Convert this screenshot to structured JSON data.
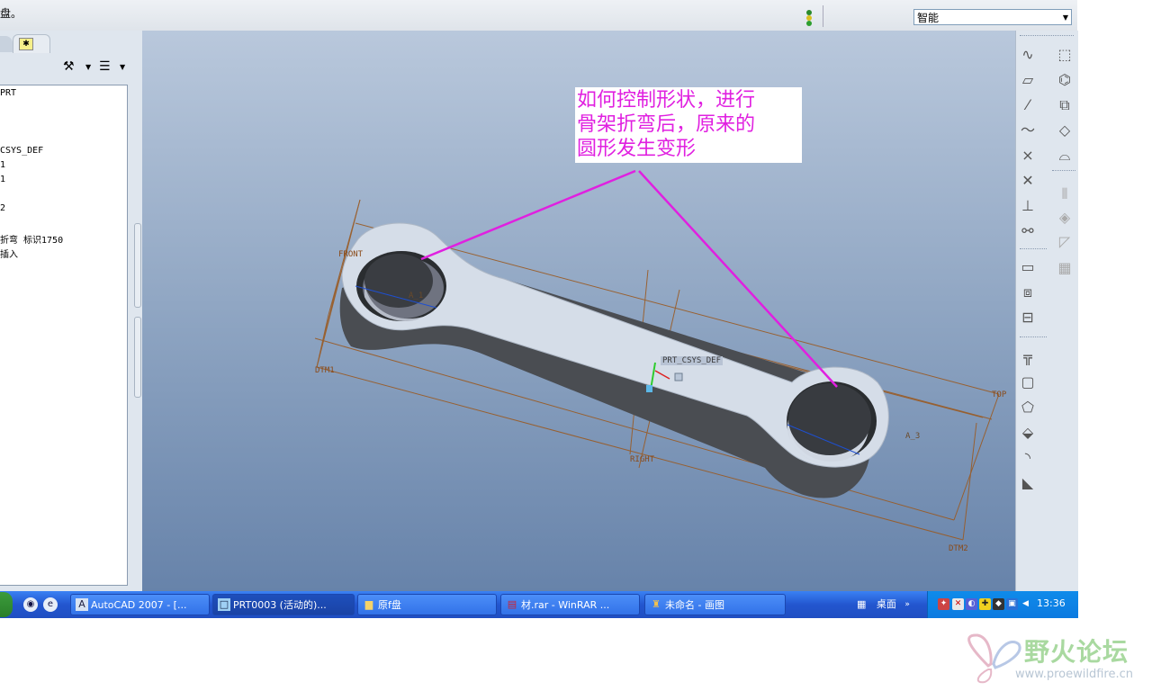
{
  "top_bar": {
    "message": "盘。",
    "filter_value": "智能"
  },
  "model_tree": {
    "items": [
      "PRT",
      "CSYS_DEF",
      "1",
      "1",
      "2",
      "折弯 标识1750",
      "插入"
    ]
  },
  "viewport": {
    "annotation_text": [
      "如何控制形状，进行",
      "骨架折弯后，原来的",
      "圆形发生变形"
    ],
    "datum_labels": {
      "front": "FRONT",
      "dtm1": "DTM1",
      "right": "RIGHT",
      "top": "TOP",
      "dtm2": "DTM2",
      "csys": "PRT_CSYS_DEF",
      "axis_a1": "A_1",
      "axis_a3": "A_3"
    },
    "annotation_color": "#e020e0"
  },
  "taskbar": {
    "tasks": [
      {
        "label": "AutoCAD 2007 - [..."
      },
      {
        "label": "PRT0003 (活动的)..."
      },
      {
        "label": "原f盘"
      },
      {
        "label": "材.rar - WinRAR ..."
      },
      {
        "label": "未命名 - 画图"
      }
    ],
    "desktop_label": "桌面",
    "clock": "13:36"
  },
  "watermark": {
    "cn": "野火论坛",
    "url": "www.proewildfire.cn"
  }
}
